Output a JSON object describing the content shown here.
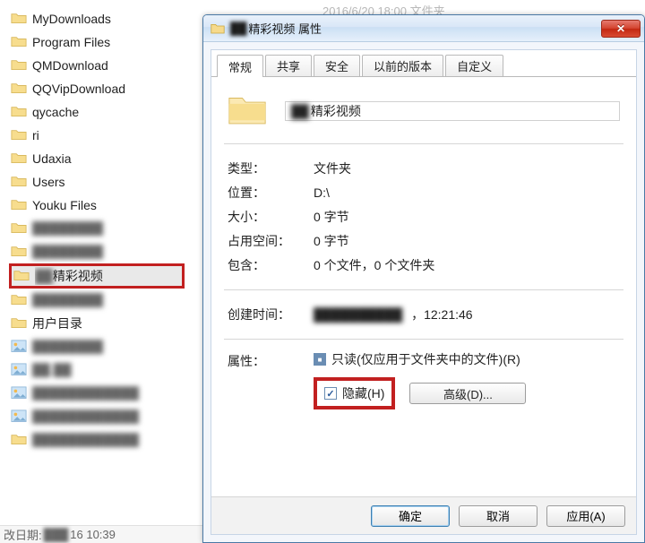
{
  "explorer": {
    "items": [
      {
        "label": "MyDownloads",
        "selected": false,
        "blur": false
      },
      {
        "label": "Program Files",
        "selected": false,
        "blur": false
      },
      {
        "label": "QMDownload",
        "selected": false,
        "blur": false
      },
      {
        "label": "QQVipDownload",
        "selected": false,
        "blur": false
      },
      {
        "label": "qycache",
        "selected": false,
        "blur": false
      },
      {
        "label": "ri",
        "selected": false,
        "blur": false
      },
      {
        "label": "Udaxia",
        "selected": false,
        "blur": false
      },
      {
        "label": "Users",
        "selected": false,
        "blur": false
      },
      {
        "label": "Youku Files",
        "selected": false,
        "blur": false
      },
      {
        "label": "████████",
        "selected": false,
        "blur": true
      },
      {
        "label": "████████",
        "selected": false,
        "blur": true
      },
      {
        "label": "██精彩视频",
        "selected": true,
        "blur": false
      },
      {
        "label": "████████",
        "selected": false,
        "blur": true
      },
      {
        "label": "用户目录",
        "selected": false,
        "blur": false
      },
      {
        "label": "████████",
        "selected": false,
        "blur": true,
        "icon": "image"
      },
      {
        "label": "██.██",
        "selected": false,
        "blur": true,
        "icon": "image"
      },
      {
        "label": "████████████",
        "selected": false,
        "blur": true,
        "icon": "image"
      },
      {
        "label": "████████████",
        "selected": false,
        "blur": true,
        "icon": "image"
      },
      {
        "label": "████████████",
        "selected": false,
        "blur": true
      }
    ],
    "status_prefix": "改日期:",
    "status_date_blur": "███",
    "status_date_suffix": "16 10:39"
  },
  "top_faint": "2016/6/20 18:00     文件夹",
  "dialog": {
    "title_blur": "██",
    "title_suffix": "精彩视频 属性",
    "close_glyph": "✕",
    "tabs": {
      "general": "常规",
      "sharing": "共享",
      "security": "安全",
      "previous": "以前的版本",
      "custom": "自定义"
    },
    "name_blur": "██",
    "name_suffix": "精彩视频",
    "props": {
      "type_key": "类型：",
      "type_val": "文件夹",
      "location_key": "位置：",
      "location_val": "D:\\",
      "size_key": "大小：",
      "size_val": "0 字节",
      "ondisk_key": "占用空间：",
      "ondisk_val": "0 字节",
      "contains_key": "包含：",
      "contains_val": "0 个文件，0 个文件夹",
      "created_key": "创建时间：",
      "created_blur": "██████████",
      "created_suffix": "，12:21:46"
    },
    "attrs": {
      "label": "属性：",
      "readonly_label": "只读(仅应用于文件夹中的文件)(R)",
      "hidden_label": "隐藏(H)",
      "advanced_label": "高级(D)..."
    },
    "buttons": {
      "ok": "确定",
      "cancel": "取消",
      "apply": "应用(A)"
    }
  }
}
